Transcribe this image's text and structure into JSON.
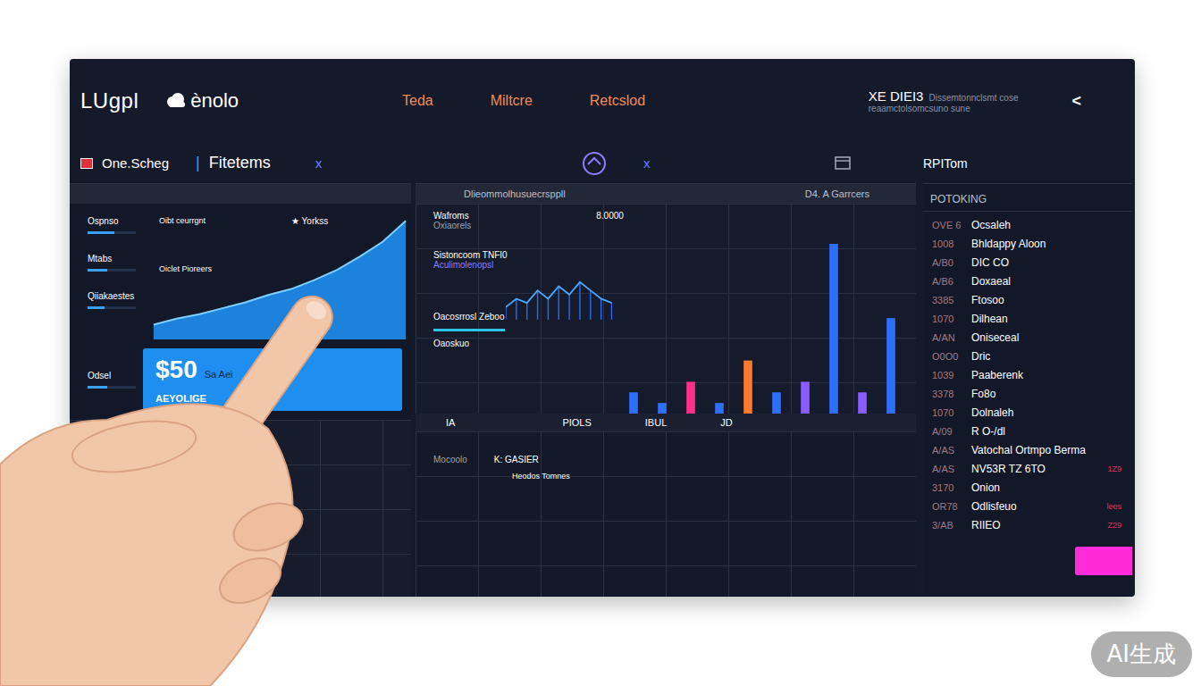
{
  "brand": {
    "name": "LUgpl",
    "product": "ènolo"
  },
  "nav": [
    {
      "label": "Teda",
      "selected": false
    },
    {
      "label": "Miltcre",
      "selected": false
    },
    {
      "label": "Retcslod",
      "selected": false
    }
  ],
  "account": {
    "title": "XE DIEI3",
    "subtitle": "Dissemtonnclsmt cose",
    "detail": "reaamctolsomcsuno sune",
    "chevron": "<"
  },
  "toolbar": {
    "flag_label": "One.Scheg",
    "divider": "|",
    "filter_label": "Fitetems",
    "close_a": "x",
    "close_b": "x",
    "panel_title": "RPITom"
  },
  "left_panel": {
    "metrics": [
      {
        "label": "Ospnso",
        "level": 0.55
      },
      {
        "label": "Mtabs",
        "level": 0.4
      },
      {
        "label": "Qiiakaestes",
        "level": 0.35
      }
    ],
    "chart_notes": [
      "Oibt ceurrgnt",
      "Oiclet Pioreers"
    ],
    "star_label": "★ Yorkss",
    "chart": {
      "values": [
        10,
        14,
        17,
        21,
        25,
        30,
        34,
        40,
        47,
        56,
        66,
        80
      ]
    },
    "card_row": {
      "label": "Odsel",
      "level": 0.4,
      "value": "$50",
      "sub": "Sa Aei",
      "card_label": "AEYOLIGE"
    }
  },
  "middle_panel": {
    "title": "Dlieommolhusuecrsppll",
    "side": "D4. A Garrcers",
    "top_label": "Wafroms",
    "top_sub": "Oxiaorels",
    "top_value": "8.0000",
    "series_title": "Sistoncoom TNFI0",
    "series_sub": "Aculimolenopsl",
    "line_title": "Oacosrrosl Zeboo",
    "line_values": [
      3,
      5,
      4,
      7,
      5,
      8,
      6,
      9,
      7,
      5,
      4
    ],
    "caption": "Oaoskuo",
    "bars": [
      {
        "value": 2,
        "color": "#2f6fff"
      },
      {
        "value": 1,
        "color": "#2f6fff"
      },
      {
        "value": 3,
        "color": "#ff2f8a"
      },
      {
        "value": 1,
        "color": "#2f6fff"
      },
      {
        "value": 5,
        "color": "#ff7a2f"
      },
      {
        "value": 2,
        "color": "#2f6fff"
      },
      {
        "value": 3,
        "color": "#8a5cff"
      },
      {
        "value": 16,
        "color": "#2f6fff"
      },
      {
        "value": 2,
        "color": "#8a5cff"
      },
      {
        "value": 9,
        "color": "#2f6fff"
      }
    ],
    "axis_labels": [
      "IA",
      "PIOLS",
      "IBUL",
      "JD"
    ],
    "footer": [
      "Mocoolo",
      "K: GASIER",
      "Heodos Tomnes"
    ]
  },
  "right_panel": {
    "title": "POTOKING",
    "rows": [
      {
        "code": "OVE 6",
        "name": "Ocsaleh",
        "note": ""
      },
      {
        "code": "1008",
        "name": "Bhldappy Aloon",
        "note": ""
      },
      {
        "code": "A/B0",
        "name": "DIC CO",
        "note": ""
      },
      {
        "code": "A/B6",
        "name": "Doxaeal",
        "note": ""
      },
      {
        "code": "3385",
        "name": "Ftosoo",
        "note": ""
      },
      {
        "code": "1070",
        "name": "Dilhean",
        "note": ""
      },
      {
        "code": "A/AN",
        "name": "Oniseceal",
        "note": ""
      },
      {
        "code": "O0O0",
        "name": "Dric",
        "note": ""
      },
      {
        "code": "1039",
        "name": "Paaberenk",
        "note": ""
      },
      {
        "code": "3378",
        "name": "Fo8o",
        "note": ""
      },
      {
        "code": "1070",
        "name": "Dolnaleh",
        "note": ""
      },
      {
        "code": "A/09",
        "name": "R O-/dl",
        "note": ""
      },
      {
        "code": "A/AS",
        "name": "Vatochal Ortmpo Berma",
        "note": ""
      },
      {
        "code": "A/AS",
        "name": "NV53R TZ 6TO",
        "note": "1Z9"
      },
      {
        "code": "3170",
        "name": "Onion",
        "note": ""
      },
      {
        "code": "OR78",
        "name": "Odlisfeuo",
        "note": "lees"
      },
      {
        "code": "3/AB",
        "name": "RIIEO",
        "note": "Z29"
      }
    ]
  },
  "watermark": "AI生成"
}
